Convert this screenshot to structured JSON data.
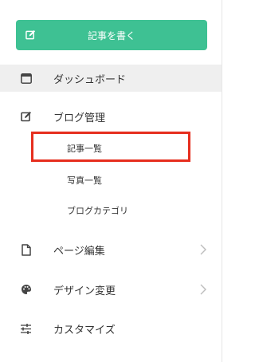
{
  "write_button": {
    "label": "記事を書く",
    "icon": "edit-icon"
  },
  "nav": {
    "dashboard": {
      "label": "ダッシュボード",
      "icon": "browser-window-icon",
      "active": true
    },
    "blog_admin": {
      "label": "ブログ管理",
      "icon": "edit-icon",
      "sub_items": [
        {
          "label": "記事一覧",
          "highlighted": true
        },
        {
          "label": "写真一覧"
        },
        {
          "label": "ブログカテゴリ"
        }
      ]
    },
    "page_edit": {
      "label": "ページ編集",
      "icon": "document-icon"
    },
    "design_change": {
      "label": "デザイン変更",
      "icon": "palette-icon"
    },
    "customize": {
      "label": "カスタマイズ",
      "icon": "sliders-icon"
    }
  },
  "colors": {
    "accent": "#3ec193",
    "active_bg": "#efefef",
    "highlight_border": "#e62e1e",
    "text": "#333333"
  }
}
